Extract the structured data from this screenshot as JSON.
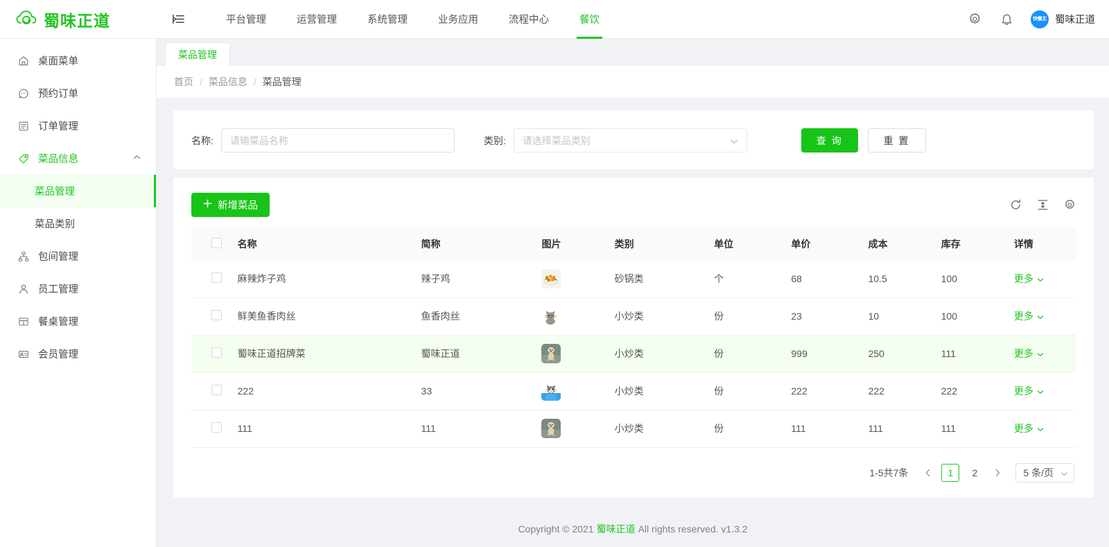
{
  "brand": {
    "name": "蜀味正道",
    "icon": "cloud-refresh-icon",
    "color": "#21c521"
  },
  "header": {
    "collapse_icon": "menu-fold-icon",
    "nav": [
      {
        "label": "平台管理",
        "active": false
      },
      {
        "label": "运营管理",
        "active": false
      },
      {
        "label": "系统管理",
        "active": false
      },
      {
        "label": "业务应用",
        "active": false
      },
      {
        "label": "流程中心",
        "active": false
      },
      {
        "label": "餐饮",
        "active": true
      }
    ],
    "settings_icon": "gear-icon",
    "bell_icon": "bell-icon",
    "avatar_text": "快餐主",
    "user_name": "蜀味正道"
  },
  "sidebar": {
    "items": [
      {
        "label": "桌面菜单",
        "icon": "home-icon",
        "active": false
      },
      {
        "label": "预约订单",
        "icon": "message-icon",
        "active": false
      },
      {
        "label": "订单管理",
        "icon": "list-icon",
        "active": false
      },
      {
        "label": "菜品信息",
        "icon": "tag-icon",
        "active": true,
        "expanded": true,
        "arrow": "chevron-up-icon"
      },
      {
        "label": "包间管理",
        "icon": "cluster-icon",
        "active": false
      },
      {
        "label": "员工管理",
        "icon": "user-icon",
        "active": false
      },
      {
        "label": "餐桌管理",
        "icon": "table-icon",
        "active": false
      },
      {
        "label": "会员管理",
        "icon": "idcard-icon",
        "active": false
      }
    ],
    "submenu": [
      {
        "label": "菜品管理",
        "active": true
      },
      {
        "label": "菜品类别",
        "active": false
      }
    ]
  },
  "tabs": [
    {
      "label": "菜品管理",
      "active": true
    }
  ],
  "breadcrumb": {
    "items": [
      "首页",
      "菜品信息",
      "菜品管理"
    ],
    "separator": "/"
  },
  "filter": {
    "name_label": "名称:",
    "name_placeholder": "请输菜品名称",
    "name_value": "",
    "category_label": "类别:",
    "category_placeholder": "请选择菜品类别",
    "category_value": "",
    "dropdown_icon": "chevron-down-icon",
    "search_button": "查 询",
    "reset_button": "重 置"
  },
  "toolbar": {
    "add_button": "新增菜品",
    "add_icon": "plus-icon",
    "refresh_icon": "reload-icon",
    "density_icon": "column-height-icon",
    "settings_icon": "gear-icon"
  },
  "table": {
    "columns": [
      "名称",
      "简称",
      "图片",
      "类别",
      "单位",
      "单价",
      "成本",
      "库存",
      "详情"
    ],
    "select_all_checkbox": "checkbox-icon",
    "more_label": "更多",
    "more_icon": "chevron-down-icon",
    "rows": [
      {
        "name": "麻辣炸子鸡",
        "short": "辣子鸡",
        "image": "spicy-chicken-photo",
        "category": "砂锅类",
        "unit": "个",
        "price": "68",
        "cost": "10.5",
        "stock": "100",
        "detail": "更多",
        "highlight": false
      },
      {
        "name": "鲜美鱼香肉丝",
        "short": "鱼香肉丝",
        "image": "cat-photo",
        "category": "小炒类",
        "unit": "份",
        "price": "23",
        "cost": "10",
        "stock": "100",
        "detail": "更多",
        "highlight": false
      },
      {
        "name": "蜀味正道招牌菜",
        "short": "蜀味正道",
        "image": "dog-photo",
        "category": "小炒类",
        "unit": "份",
        "price": "999",
        "cost": "250",
        "stock": "111",
        "detail": "更多",
        "highlight": true
      },
      {
        "name": "222",
        "short": "33",
        "image": "kitten-photo",
        "category": "小炒类",
        "unit": "份",
        "price": "222",
        "cost": "222",
        "stock": "222",
        "detail": "更多",
        "highlight": false
      },
      {
        "name": "111",
        "short": "111",
        "image": "dog-photo",
        "category": "小炒类",
        "unit": "份",
        "price": "111",
        "cost": "111",
        "stock": "111",
        "detail": "更多",
        "highlight": false
      }
    ]
  },
  "pagination": {
    "total_text": "1-5共7条",
    "prev_icon": "chevron-left-icon",
    "next_icon": "chevron-right-icon",
    "pages": [
      "1",
      "2"
    ],
    "current_page": "1",
    "page_size": "5 条/页",
    "page_size_icon": "chevron-down-icon"
  },
  "footer": {
    "prefix": "Copyright © 2021",
    "brand": "蜀味正道",
    "suffix": "All rights reserved. v1.3.2"
  }
}
